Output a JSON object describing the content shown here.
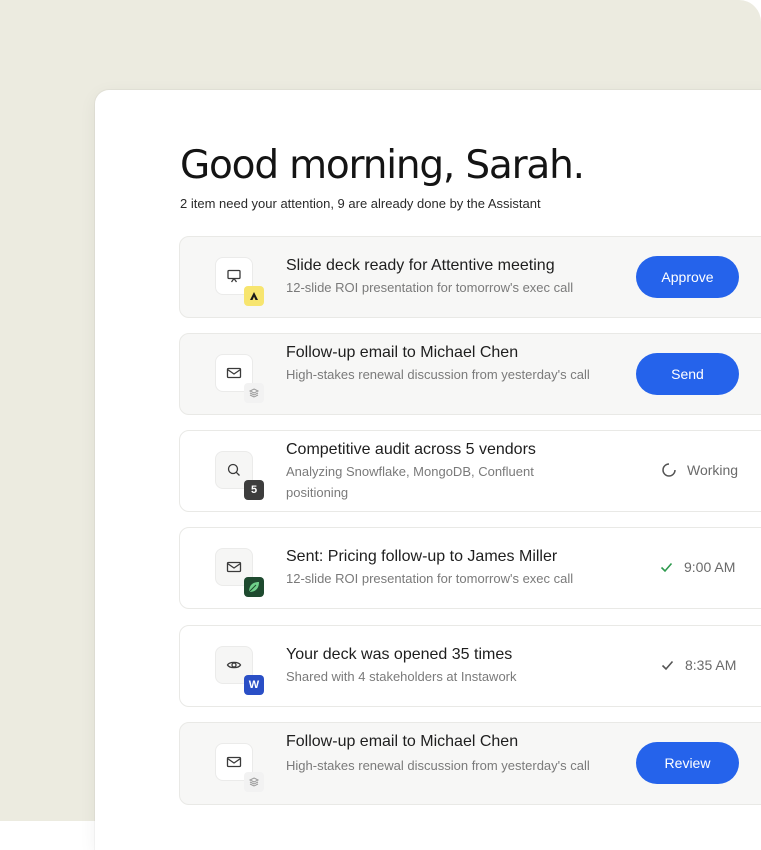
{
  "header": {
    "greeting": "Good morning, Sarah.",
    "subtitle": "2 item need your attention, 9 are already done by the Assistant"
  },
  "items": [
    {
      "title": "Slide deck ready for Attentive meeting",
      "description": "12-slide ROI presentation for tomorrow's exec call",
      "icon": "presentation-icon",
      "badge": "attentive-logo",
      "action": "Approve"
    },
    {
      "title": "Follow-up email to Michael Chen",
      "description": "High-stakes renewal discussion from yesterday's call",
      "icon": "mail-icon",
      "badge": "layers-logo",
      "action": "Send"
    },
    {
      "title": "Competitive audit across 5 vendors",
      "description": "Analyzing Snowflake, MongoDB, Confluent positioning",
      "icon": "search-icon",
      "badge_text": "5",
      "status": "Working"
    },
    {
      "title": "Sent: Pricing follow-up to James Miller",
      "description": "12-slide ROI presentation for tomorrow's exec call",
      "icon": "mail-icon",
      "badge": "leaf-logo",
      "status": "9:00 AM"
    },
    {
      "title": "Your deck was opened 35 times",
      "description": "Shared with 4 stakeholders at Instawork",
      "icon": "eye-icon",
      "badge_text": "W",
      "status": "8:35 AM"
    },
    {
      "title": "Follow-up email to Michael Chen",
      "description": "High-stakes renewal discussion from yesterday's call",
      "icon": "mail-icon",
      "badge": "layers-logo",
      "action": "Review"
    }
  ],
  "colors": {
    "accent": "#2563eb",
    "backdrop": "#ecebe0",
    "check": "#2e9a4e",
    "badge_yellow": "#f7e56f",
    "badge_dark": "#3d3d3d",
    "badge_green": "#1e4a2f",
    "badge_blue": "#2a4fc6"
  }
}
